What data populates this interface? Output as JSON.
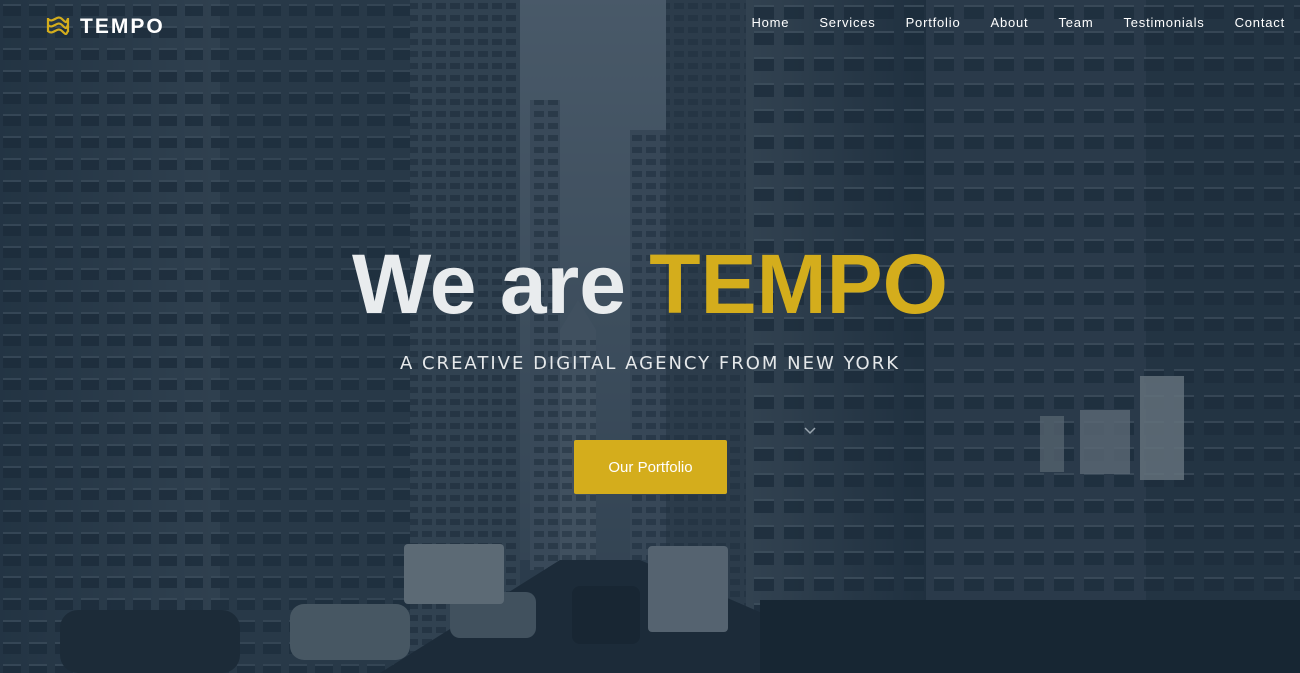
{
  "brand": {
    "name": "TEMPO",
    "logo_icon": "wave-flag-icon",
    "accent_color": "#d4ad1c"
  },
  "nav": {
    "items": [
      {
        "label": "Home"
      },
      {
        "label": "Services"
      },
      {
        "label": "Portfolio"
      },
      {
        "label": "About"
      },
      {
        "label": "Team"
      },
      {
        "label": "Testimonials"
      },
      {
        "label": "Contact"
      }
    ]
  },
  "hero": {
    "headline_prefix": "We are",
    "headline_accent": "TEMPO",
    "tagline": "A CREATIVE DIGITAL AGENCY FROM NEW YORK",
    "cta_label": "Our Portfolio",
    "background": "city-street-photo",
    "overlay_color": "#102436"
  }
}
